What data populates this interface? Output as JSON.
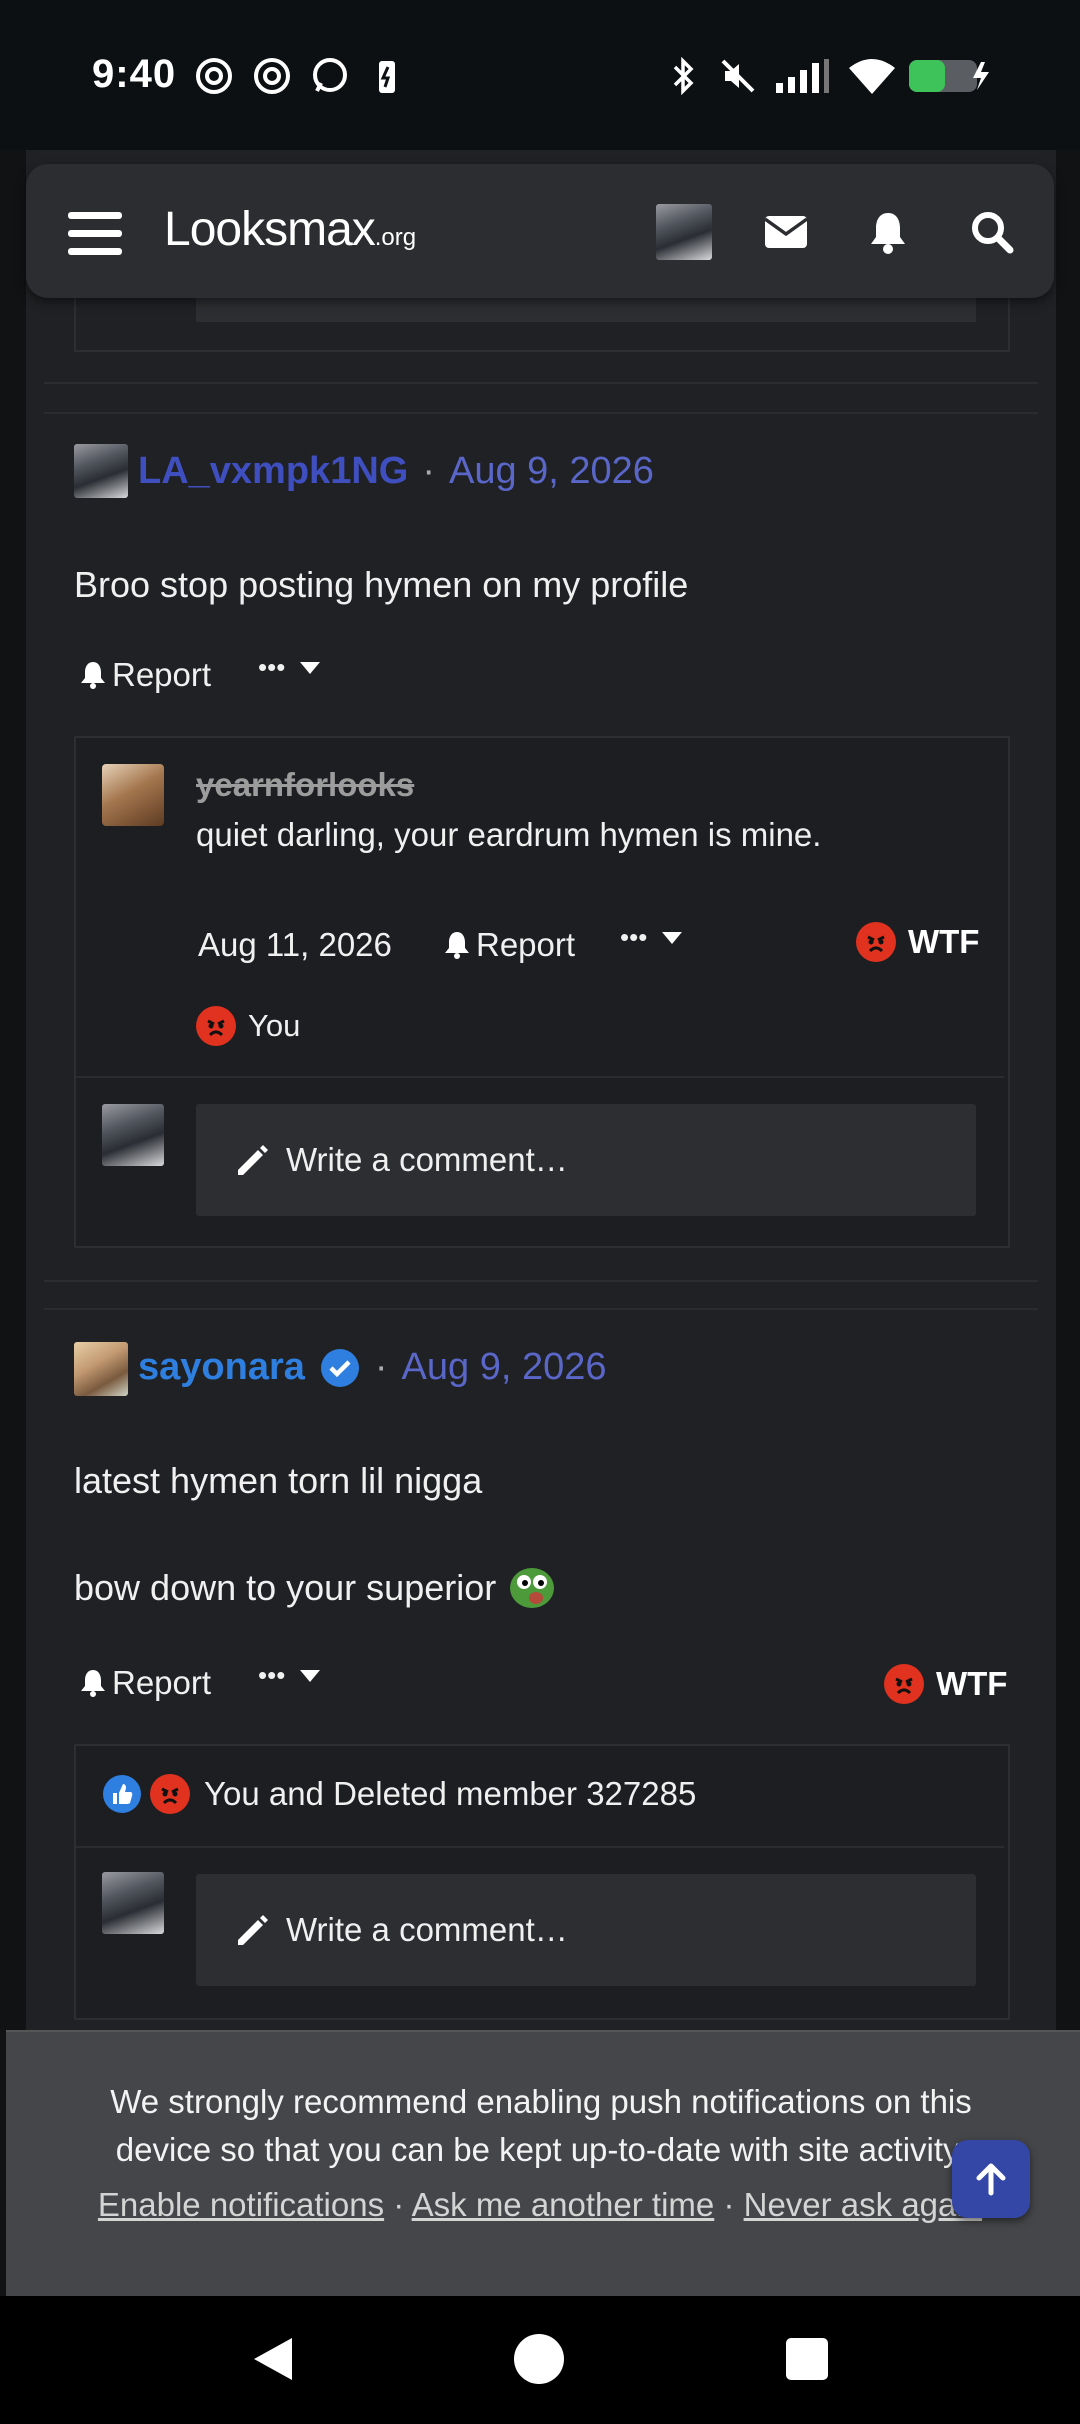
{
  "status_bar": {
    "time": "9:40"
  },
  "header": {
    "logo_main": "Looksmax",
    "logo_suffix": ".org"
  },
  "posts": [
    {
      "username": "LA_vxmpk1NG",
      "date": "Aug 9, 2026",
      "body": "Broo stop posting hymen on my profile",
      "report_label": "Report",
      "more_label": "•••",
      "comment": {
        "username": "yearnforlooks",
        "text": "quiet darling, your eardrum hymen is mine.",
        "date": "Aug 11, 2026",
        "report_label": "Report",
        "more_label": "•••",
        "reaction_label": "WTF",
        "reacted_by": "You"
      },
      "write_comment_label": "Write a comment…"
    },
    {
      "username": "sayonara",
      "date": "Aug 9, 2026",
      "body_line1": "latest hymen torn lil nigga",
      "body_line2": "bow down to your superior",
      "report_label": "Report",
      "more_label": "•••",
      "reaction_label": "WTF",
      "reactions_summary": "You and Deleted member 327285",
      "write_comment_label": "Write a comment…"
    }
  ],
  "banner": {
    "text": "We strongly recommend enabling push notifications on this device so that you can be kept up-to-date with site activity.",
    "enable_label": "Enable notifications",
    "later_label": "Ask me another time",
    "never_label": "Never ask again",
    "separator": "·"
  },
  "colors": {
    "accent": "#3f4fbf",
    "verified": "#2e7fe0",
    "angry": "#e0321f"
  }
}
